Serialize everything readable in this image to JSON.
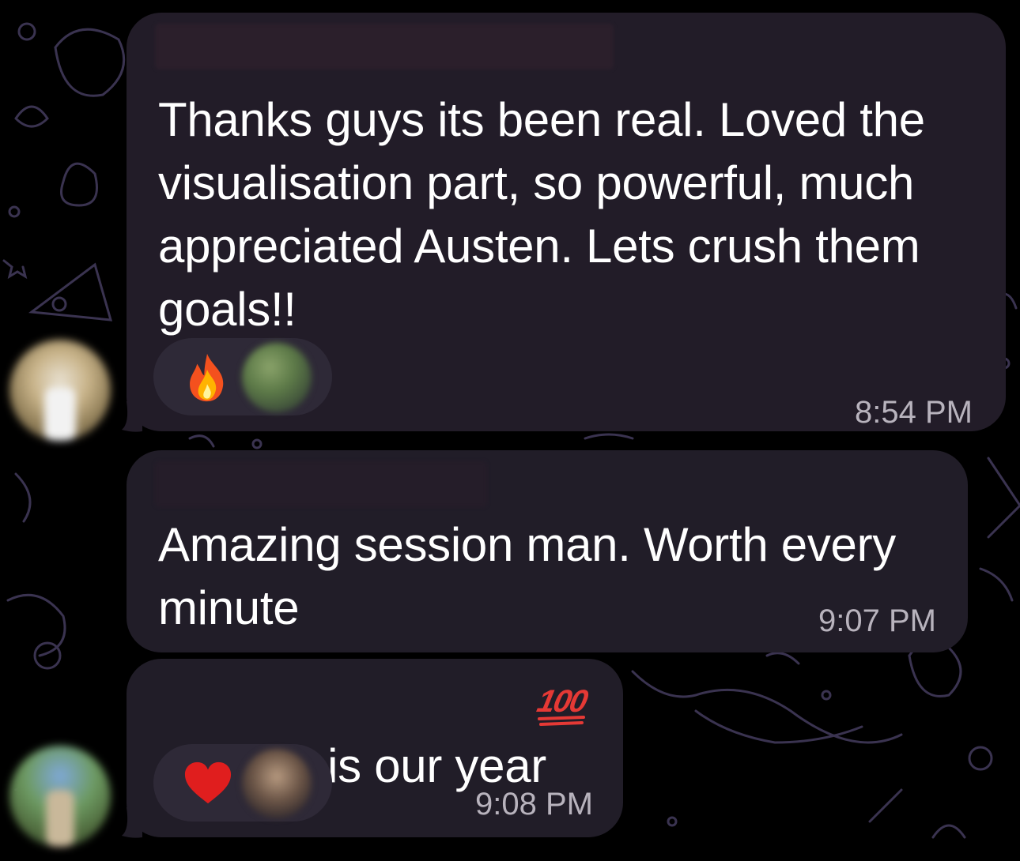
{
  "messages": [
    {
      "text": "Thanks guys its been real. Loved the\nvisualisation part, so powerful, much\nappreciated Austen. Lets crush them\ngoals!!",
      "time": "8:54 PM",
      "reactions": [
        "fire-emoji",
        "reactor-avatar"
      ]
    },
    {
      "text": "Amazing session man. Worth every\nminute",
      "time": "9:07 PM"
    },
    {
      "text": "2023 is our year",
      "inline_emoji": "hundred-points-emoji",
      "time": "9:08 PM",
      "reactions": [
        "red-heart-emoji",
        "reactor-avatar"
      ]
    }
  ],
  "colors": {
    "background": "#000000",
    "bubble": "#221c28",
    "reaction_pill": "#2e2937",
    "timestamp": "#b8b3bd",
    "doodle_pattern": "#3a3350"
  },
  "emoji_100": "100"
}
